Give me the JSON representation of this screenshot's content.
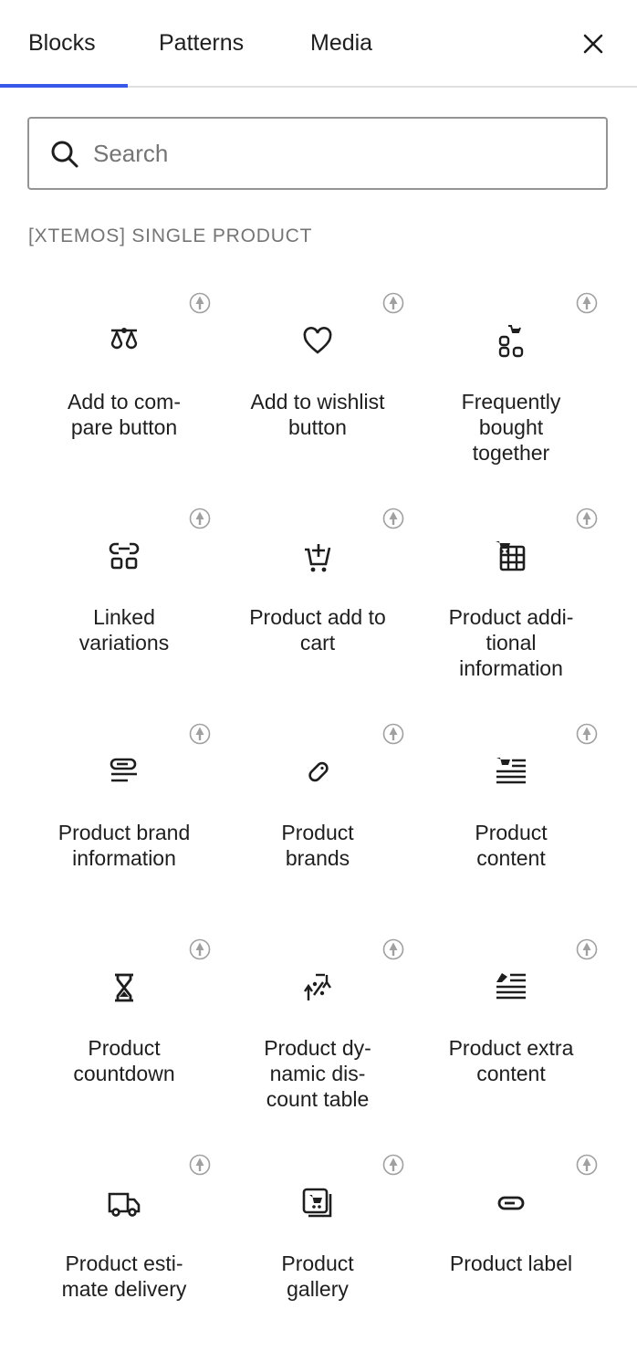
{
  "tabs": [
    {
      "label": "Blocks",
      "active": true
    },
    {
      "label": "Patterns",
      "active": false
    },
    {
      "label": "Media",
      "active": false
    }
  ],
  "close_icon": "close-icon",
  "search": {
    "placeholder": "Search",
    "value": ""
  },
  "section": {
    "title": "[XTEMOS] SINGLE PRODUCT"
  },
  "colors": {
    "accent": "#3858e9",
    "badge": "#a0a0a0",
    "text": "#1e1e1e",
    "muted": "#757575"
  },
  "blocks": [
    {
      "label": "Add to com-\npare button",
      "icon": "compare-icon"
    },
    {
      "label": "Add to wishlist\nbutton",
      "icon": "heart-icon"
    },
    {
      "label": "Frequently\nbought\ntogether",
      "icon": "bundle-icon"
    },
    {
      "label": "Linked\nvariations",
      "icon": "linked-variations-icon"
    },
    {
      "label": "Product add to\ncart",
      "icon": "cart-add-icon"
    },
    {
      "label": "Product addi-\ntional\ninformation",
      "icon": "table-cart-icon"
    },
    {
      "label": "Product brand\ninformation",
      "icon": "brand-info-icon"
    },
    {
      "label": "Product\nbrands",
      "icon": "tag-icon"
    },
    {
      "label": "Product\ncontent",
      "icon": "content-icon"
    },
    {
      "label": "Product\ncountdown",
      "icon": "hourglass-icon"
    },
    {
      "label": "Product dy-\nnamic dis-\ncount table",
      "icon": "discount-icon"
    },
    {
      "label": "Product extra\ncontent",
      "icon": "extra-content-icon"
    },
    {
      "label": "Product esti-\nmate delivery",
      "icon": "truck-icon"
    },
    {
      "label": "Product\ngallery",
      "icon": "gallery-icon"
    },
    {
      "label": "Product label",
      "icon": "label-icon"
    }
  ]
}
